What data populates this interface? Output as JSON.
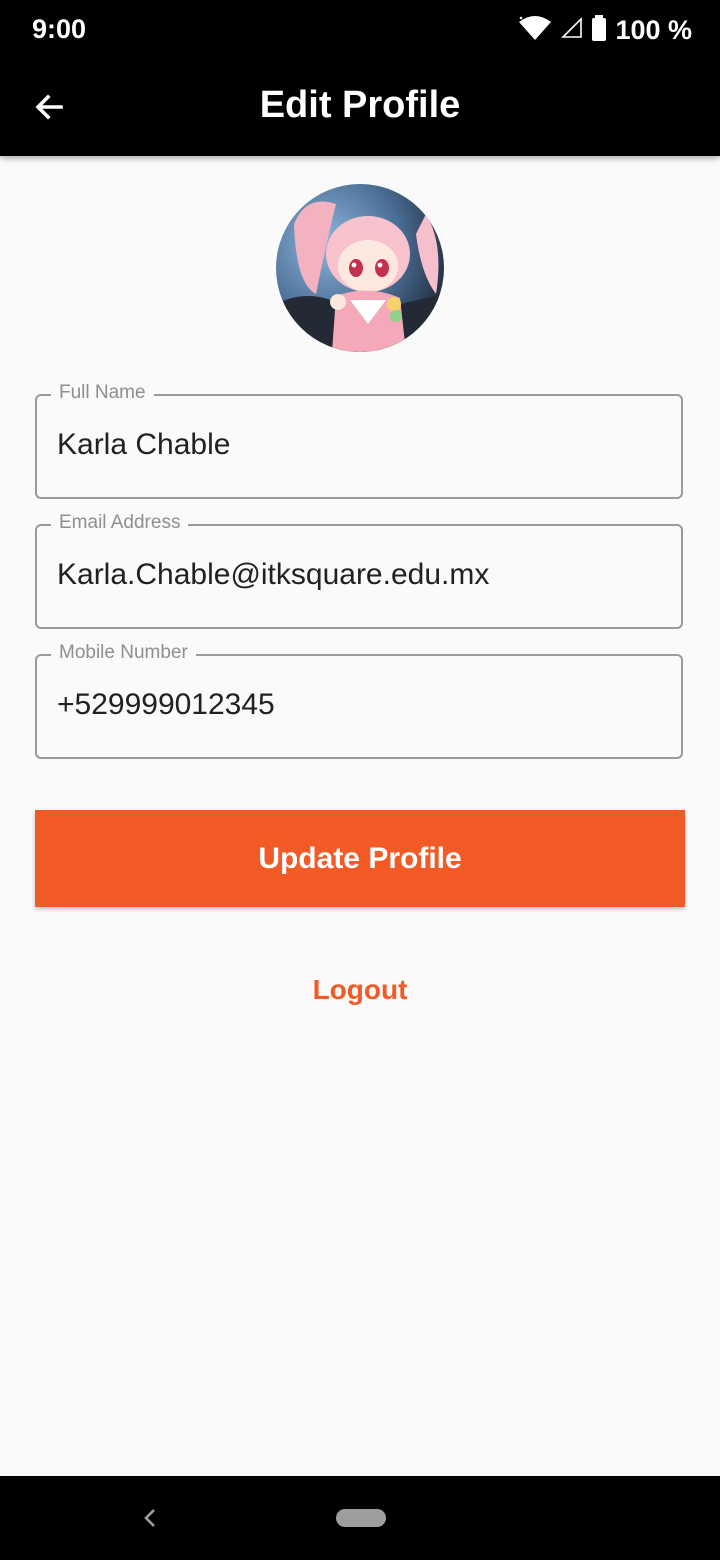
{
  "status": {
    "time": "9:00",
    "battery": "100 %"
  },
  "app_bar": {
    "title": "Edit Profile"
  },
  "fields": [
    {
      "label": "Full Name",
      "value": "Karla Chable"
    },
    {
      "label": "Email Address",
      "value": "Karla.Chable@itksquare.edu.mx"
    },
    {
      "label": "Mobile Number",
      "value": "+529999012345"
    }
  ],
  "actions": {
    "update_label": "Update Profile",
    "logout_label": "Logout"
  },
  "colors": {
    "accent": "#f25a26",
    "appbar": "#000000",
    "background": "#fafafa"
  }
}
